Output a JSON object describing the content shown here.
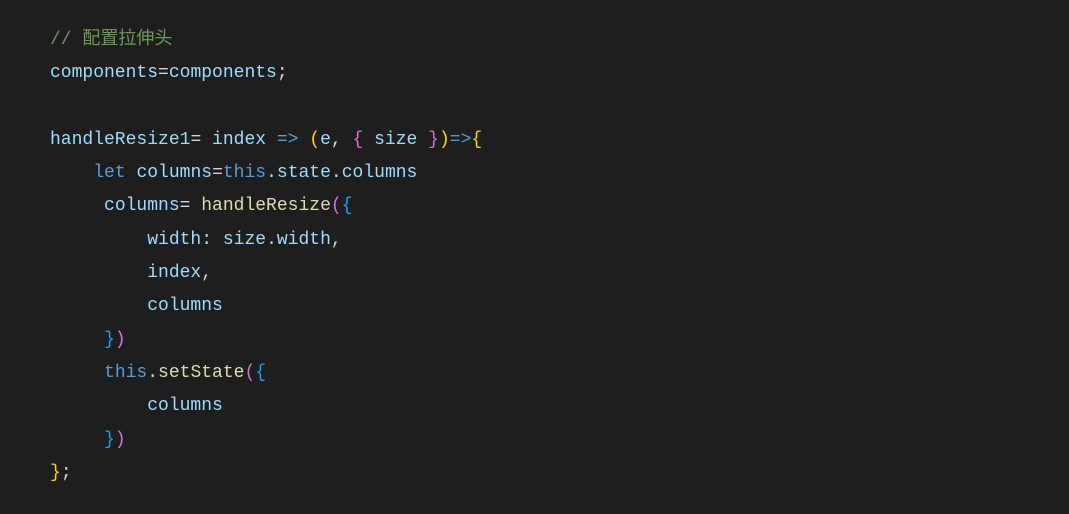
{
  "code": {
    "line1_comment": "// 配置拉伸头",
    "line2_var1": "components",
    "line2_op": "=",
    "line2_var2": "components",
    "line2_semi": ";",
    "line4_fn": "handleResize1",
    "line4_eq": "= ",
    "line4_param1": "index",
    "line4_arrow1": " => ",
    "line4_open1": "(",
    "line4_param2": "e",
    "line4_comma": ", ",
    "line4_open2": "{ ",
    "line4_param3": "size",
    "line4_close2": " }",
    "line4_close1": ")",
    "line4_arrow2": "=>",
    "line4_open3": "{",
    "line5_let": "let",
    "line5_sp": " ",
    "line5_var": "columns",
    "line5_eq": "=",
    "line5_this": "this",
    "line5_dot1": ".",
    "line5_state": "state",
    "line5_dot2": ".",
    "line5_cols": "columns",
    "line6_var": "columns",
    "line6_eq": "= ",
    "line6_fn": "handleResize",
    "line6_open1": "(",
    "line6_open2": "{",
    "line7_key": "width",
    "line7_colon": ": ",
    "line7_val": "size",
    "line7_dot": ".",
    "line7_prop": "width",
    "line7_comma": ",",
    "line8_key": "index",
    "line8_comma": ",",
    "line9_key": "columns",
    "line10_close2": "}",
    "line10_close1": ")",
    "line11_this": "this",
    "line11_dot": ".",
    "line11_fn": "setState",
    "line11_open1": "(",
    "line11_open2": "{",
    "line12_key": "columns",
    "line13_close2": "}",
    "line13_close1": ")",
    "line14_close": "}",
    "line14_semi": ";"
  }
}
